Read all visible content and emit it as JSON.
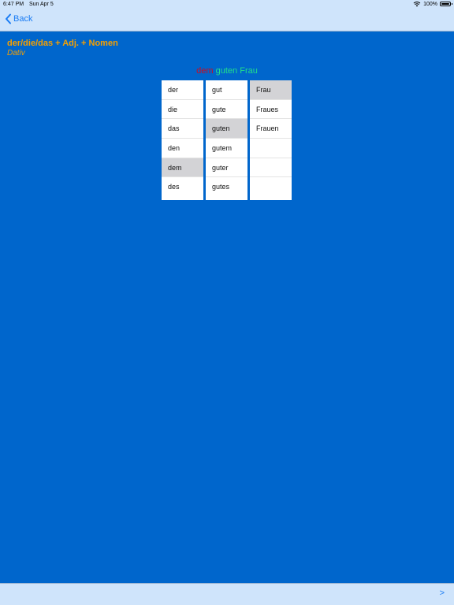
{
  "status_bar": {
    "time": "6:47 PM",
    "date": "Sun Apr 5",
    "battery": "100%"
  },
  "nav": {
    "back_label": "Back"
  },
  "lesson": {
    "title": "der/die/das + Adj. + Nomen",
    "case": "Dativ"
  },
  "result": {
    "article": "dem",
    "adjective": "guten",
    "noun": "Frau"
  },
  "columns": {
    "article": {
      "options": [
        "der",
        "die",
        "das",
        "den",
        "dem",
        "des"
      ],
      "selected": "dem"
    },
    "adjective": {
      "options": [
        "gut",
        "gute",
        "guten",
        "gutem",
        "guter",
        "gutes"
      ],
      "selected": "guten"
    },
    "noun": {
      "options": [
        "Frau",
        "Fraues",
        "Frauen",
        "",
        "",
        ""
      ],
      "selected": "Frau"
    }
  },
  "toolbar": {
    "next_label": ">"
  },
  "colors": {
    "background": "#0066cc",
    "bars": "#cfe4fb",
    "accent": "#1a7cf4",
    "title": "#f5a000",
    "article_result": "#d10a1a",
    "correct_result": "#20e08a"
  }
}
